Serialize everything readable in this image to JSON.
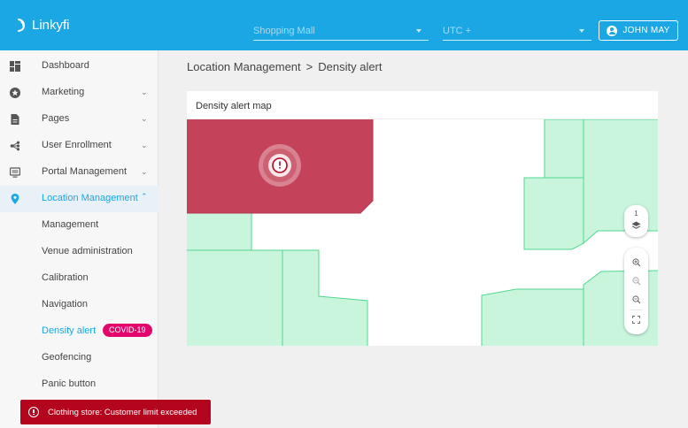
{
  "header": {
    "logo_text": "Linkyfi",
    "venue_select": "Shopping Mall",
    "timezone_select": "UTC +",
    "user_button": "JOHN MAY"
  },
  "sidebar": {
    "items": [
      {
        "label": "Dashboard",
        "icon": "dashboard-icon"
      },
      {
        "label": "Marketing",
        "icon": "star-icon"
      },
      {
        "label": "Pages",
        "icon": "page-icon"
      },
      {
        "label": "User Enrollment",
        "icon": "share-icon"
      },
      {
        "label": "Portal Management",
        "icon": "screen-icon"
      },
      {
        "label": "Location Management",
        "icon": "location-pin-icon"
      }
    ],
    "subitems": [
      {
        "label": "Management"
      },
      {
        "label": "Venue administration"
      },
      {
        "label": "Calibration"
      },
      {
        "label": "Navigation"
      },
      {
        "label": "Density alert"
      },
      {
        "label": "Geofencing"
      },
      {
        "label": "Panic button"
      }
    ],
    "badge": "COVID-19"
  },
  "breadcrumb": {
    "parent": "Location Management",
    "separator": ">",
    "current": "Density alert"
  },
  "map_card": {
    "title": "Density alert map",
    "floor_level": "1",
    "alert_zone_color": "#c5435a",
    "zone_color": "#c8f5dc",
    "zone_border_color": "#4fd88f"
  },
  "toast": {
    "message": "Clothing store: Customer limit exceeded"
  },
  "colors": {
    "brand": "#1aa7e3",
    "alert": "#b3051e",
    "badge": "#e2066c"
  }
}
